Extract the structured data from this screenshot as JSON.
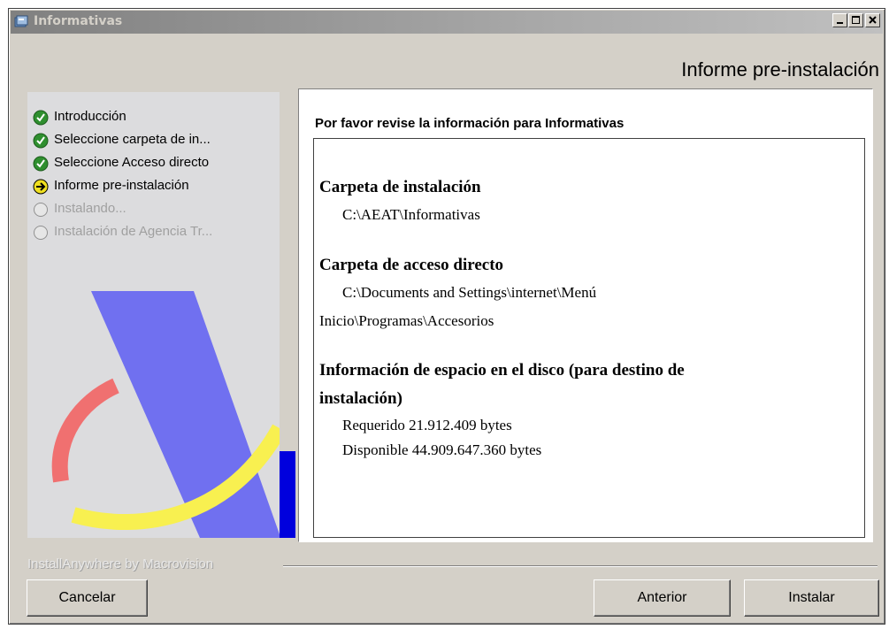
{
  "window": {
    "title": "Informativas"
  },
  "header": {
    "title": "Informe pre-instalación"
  },
  "steps": [
    {
      "label": "Introducción",
      "state": "done",
      "icon": "check-circle-icon"
    },
    {
      "label": "Seleccione carpeta de in...",
      "state": "done",
      "icon": "check-circle-icon"
    },
    {
      "label": "Seleccione  Acceso directo",
      "state": "done",
      "icon": "check-circle-icon"
    },
    {
      "label": "Informe pre-instalación",
      "state": "current",
      "icon": "arrow-circle-icon"
    },
    {
      "label": "Instalando...",
      "state": "pending",
      "icon": "empty-circle-icon"
    },
    {
      "label": "Instalación de Agencia Tr...",
      "state": "pending",
      "icon": "empty-circle-icon"
    }
  ],
  "content": {
    "prompt": "Por favor revise la información para Informativas",
    "install_folder_heading": "Carpeta de instalación",
    "install_folder_value": "C:\\AEAT\\Informativas",
    "shortcut_heading": "Carpeta de acceso directo",
    "shortcut_value_line1": "C:\\Documents and Settings\\internet\\Menú",
    "shortcut_value_line2": "Inicio\\Programas\\Accesorios",
    "disk_heading_line1": "Información de espacio en el disco (para destino de",
    "disk_heading_line2": "instalación)",
    "required": "Requerido 21.912.409 bytes",
    "available": "Disponible 44.909.647.360 bytes"
  },
  "footer": {
    "branding": "InstallAnywhere by Macrovision"
  },
  "buttons": {
    "cancel": "Cancelar",
    "back": "Anterior",
    "install": "Instalar"
  },
  "colors": {
    "done": "#2f8f2f",
    "current": "#f0e020",
    "logo_blue": "#7070f0",
    "logo_yellow": "#f8f050",
    "logo_red": "#f07070"
  }
}
